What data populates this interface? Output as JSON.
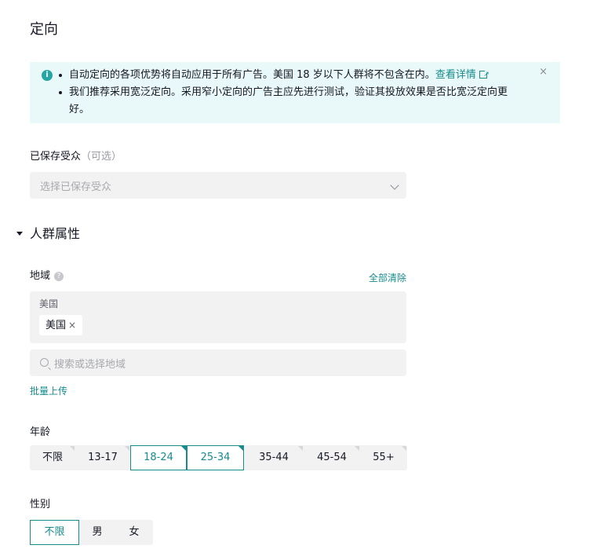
{
  "page": {
    "title": "定向"
  },
  "alert": {
    "line1": "自动定向的各项优势将自动应用于所有广告。美国 18 岁以下人群将不包含在内。",
    "line1_link": "查看详情",
    "line2a": "我们推荐采用宽泛定向。采用窄小定向的广告主应先进行测试，验证其投放效果是否比宽泛定向更",
    "line2b": "好。",
    "info_icon_glyph": "i",
    "close_glyph": "×"
  },
  "saved_audience": {
    "label": "已保存受众",
    "optional": "（可选）",
    "placeholder": "选择已保存受众"
  },
  "demographics": {
    "title": "人群属性",
    "region": {
      "label": "地域",
      "clear_all": "全部清除",
      "group_name": "美国",
      "chips": [
        "美国"
      ],
      "chip_remove": "×",
      "search_placeholder": "搜索或选择地域",
      "bulk_upload": "批量上传"
    },
    "age": {
      "label": "年龄",
      "options": [
        "不限",
        "13-17",
        "18-24",
        "25-34",
        "35-44",
        "45-54",
        "55+"
      ],
      "selected": [
        "18-24",
        "25-34"
      ]
    },
    "gender": {
      "label": "性别",
      "options": [
        "不限",
        "男",
        "女"
      ],
      "selected": "不限"
    }
  },
  "colors": {
    "accent": "#168c8c",
    "alert_bg": "#e9f8f8",
    "field_bg": "#f2f2f3"
  }
}
